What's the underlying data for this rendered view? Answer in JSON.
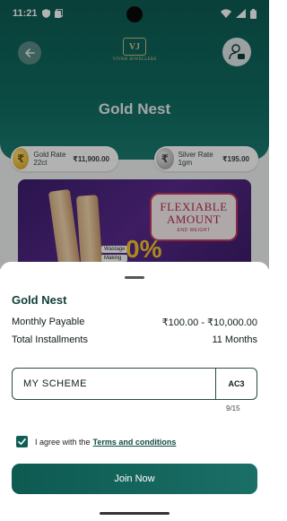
{
  "status_bar": {
    "time": "11:21"
  },
  "header": {
    "back_icon": "arrow-left-icon",
    "logo": {
      "mark": "VJ",
      "text": "VIVAH JEWELLERS"
    },
    "profile_icon": "user-settings-icon",
    "title": "Gold Nest"
  },
  "rates": {
    "gold": {
      "icon": "rupee-coin-icon",
      "label": "Gold Rate 22ct",
      "value": "₹11,900.00"
    },
    "silver": {
      "icon": "rupee-coin-icon",
      "label": "Silver Rate 1gm",
      "value": "₹195.00"
    }
  },
  "banner": {
    "title": "FLEXIABLE AMOUNT",
    "subtitle": "END WEIGHT",
    "tags": [
      "Wastage",
      "Making"
    ],
    "percent": "0%"
  },
  "sheet": {
    "title": "Gold Nest",
    "monthly_payable_label": "Monthly Payable",
    "monthly_payable_value": "₹100.00 - ₹10,000.00",
    "total_installments_label": "Total Installments",
    "total_installments_value": "11 Months",
    "scheme_input_value": "MY SCHEME",
    "scheme_suffix": "AC3",
    "counter": "9/15",
    "agree_text": "I agree with the",
    "terms_link": "Terms and conditions",
    "join_button": "Join Now"
  },
  "colors": {
    "primary": "#0f5e55",
    "header": "#0d5c53",
    "accent_gold": "#d9a419"
  }
}
